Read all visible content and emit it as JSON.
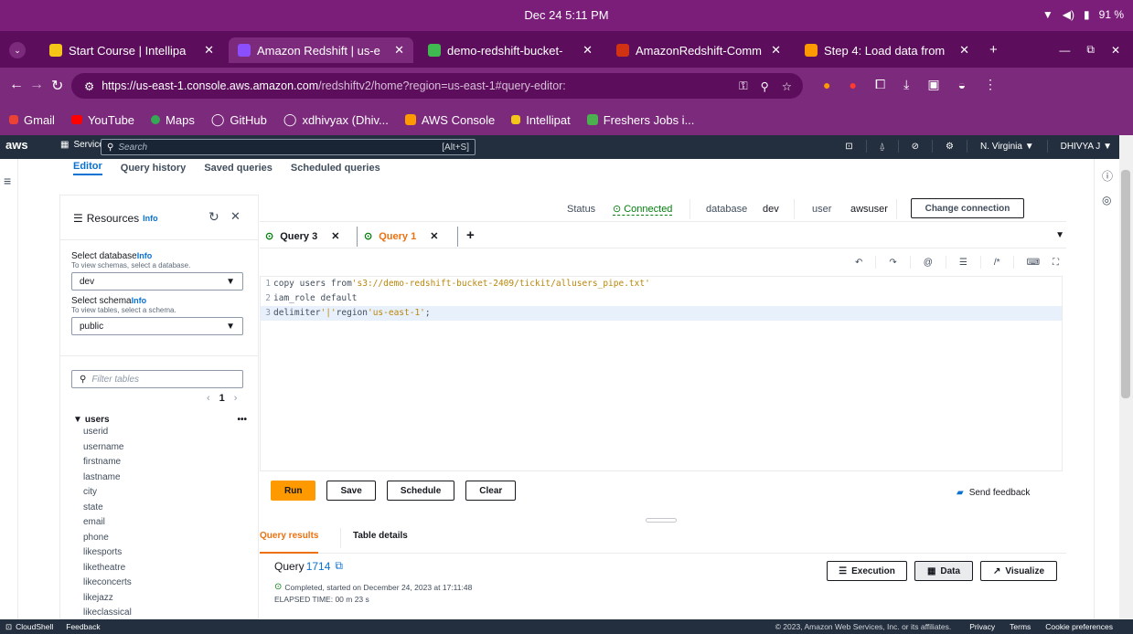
{
  "os": {
    "clock": "Dec 24   5:11 PM",
    "battery": "91 %"
  },
  "tabs": [
    {
      "label": "Start Course | Intellipa",
      "color": "#f5c518",
      "active": false
    },
    {
      "label": "Amazon Redshift | us-e",
      "color": "#8c4fff",
      "active": true
    },
    {
      "label": "demo-redshift-bucket-",
      "color": "#3fb950",
      "active": false
    },
    {
      "label": "AmazonRedshift-Comm",
      "color": "#d13212",
      "active": false
    },
    {
      "label": "Step 4: Load data from",
      "color": "#ff9900",
      "active": false
    }
  ],
  "url": {
    "host": "https://us-east-1.console.aws.amazon.com",
    "path": "/redshiftv2/home?region=us-east-1#query-editor:"
  },
  "bookmarks": [
    {
      "label": "Gmail",
      "color": "#ea4335"
    },
    {
      "label": "YouTube",
      "color": "#ff0000"
    },
    {
      "label": "Maps",
      "color": "#34a853"
    },
    {
      "label": "GitHub",
      "color": "#ffffff"
    },
    {
      "label": "xdhivyax (Dhiv...",
      "color": "#ffffff"
    },
    {
      "label": "AWS Console",
      "color": "#ff9900"
    },
    {
      "label": "Intellipat",
      "color": "#f5c518"
    },
    {
      "label": "Freshers Jobs i...",
      "color": "#4caf50"
    }
  ],
  "aws": {
    "logo": "aws",
    "services": "Services",
    "search_placeholder": "Search",
    "search_kbd": "[Alt+S]",
    "region": "N. Virginia ▼",
    "user": "DHIVYA J ▼"
  },
  "editor_tabs": [
    "Editor",
    "Query history",
    "Saved queries",
    "Scheduled queries"
  ],
  "resources": {
    "title": "Resources",
    "info": "Info",
    "db_label": "Select database",
    "db_hint": "To view schemas, select a database.",
    "db_value": "dev",
    "schema_label": "Select schema",
    "schema_hint": "To view tables, select a schema.",
    "schema_value": "public",
    "filter_placeholder": "Filter tables",
    "page": "1",
    "table": "users",
    "columns": [
      "userid",
      "username",
      "firstname",
      "lastname",
      "city",
      "state",
      "email",
      "phone",
      "likesports",
      "liketheatre",
      "likeconcerts",
      "likejazz",
      "likeclassical"
    ]
  },
  "status": {
    "status_label": "Status",
    "status_value": "Connected",
    "db_label": "database",
    "db_value": "dev",
    "user_label": "user",
    "user_value": "awsuser",
    "change_btn": "Change connection"
  },
  "query_tabs": [
    "Query 3",
    "Query 1"
  ],
  "code": {
    "l1_a": "copy users from ",
    "l1_b": "'s3://demo-redshift-bucket-2409/tickit/allusers_pipe.txt'",
    "l2": "iam_role default",
    "l3_a": "delimiter ",
    "l3_b": "'|'",
    "l3_c": " region ",
    "l3_d": "'us-east-1'",
    "l3_e": ";"
  },
  "buttons": {
    "run": "Run",
    "save": "Save",
    "schedule": "Schedule",
    "clear": "Clear",
    "feedback": "Send feedback"
  },
  "results": {
    "tab_results": "Query results",
    "tab_details": "Table details",
    "query_prefix": "Query ",
    "query_id": "1714",
    "completed": "Completed, started on December 24, 2023 at 17:11:48",
    "elapsed": "ELAPSED TIME: 00 m 23 s",
    "execution": "Execution",
    "data": "Data",
    "visualize": "Visualize"
  },
  "footer": {
    "cloudshell": "CloudShell",
    "feedback": "Feedback",
    "copyright": "© 2023, Amazon Web Services, Inc. or its affiliates.",
    "privacy": "Privacy",
    "terms": "Terms",
    "cookies": "Cookie preferences"
  }
}
